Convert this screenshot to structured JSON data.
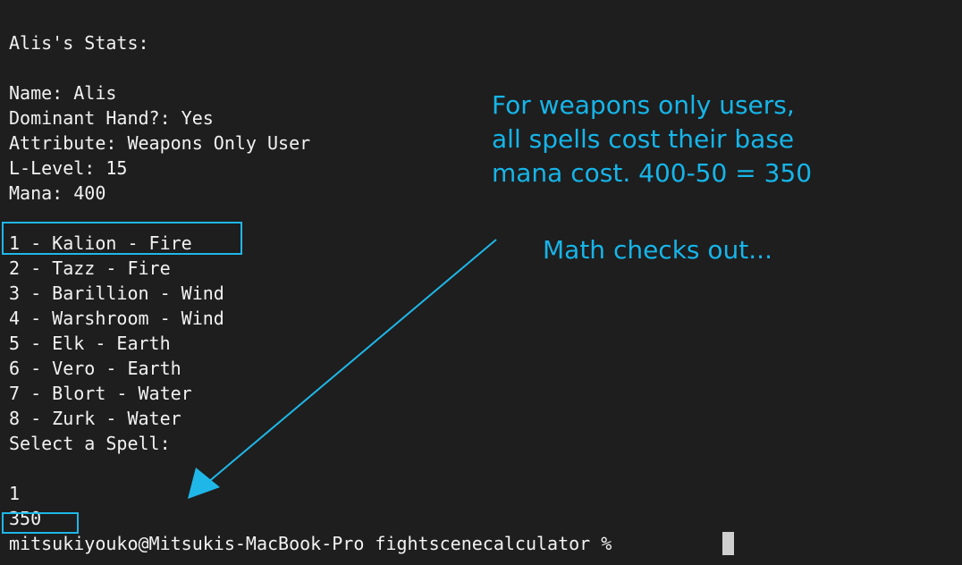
{
  "terminal": {
    "lines": [
      "Alis's Stats:",
      "Name: Alis",
      "Dominant Hand?: Yes",
      "Attribute: Weapons Only User",
      "L-Level: 15",
      "Mana: 400",
      "1 - Kalion - Fire",
      "2 - Tazz - Fire",
      "3 - Barillion - Wind",
      "4 - Warshroom - Wind",
      "5 - Elk - Earth",
      "6 - Vero - Earth",
      "7 - Blort - Water",
      "8 - Zurk - Water",
      "Select a Spell:",
      "1",
      "350",
      "mitsukiyouko@Mitsukis-MacBook-Pro fightscenecalculator % "
    ]
  },
  "annotations": {
    "note_1": "For weapons only users,",
    "note_2": "all spells cost their base",
    "note_3": "mana cost. 400-50 = 350",
    "note_4": "Math checks out...",
    "color": "#16b5e9"
  },
  "colors": {
    "background": "#1e1e1e",
    "text": "#f2f2f2",
    "annotation": "#16b5e9"
  }
}
